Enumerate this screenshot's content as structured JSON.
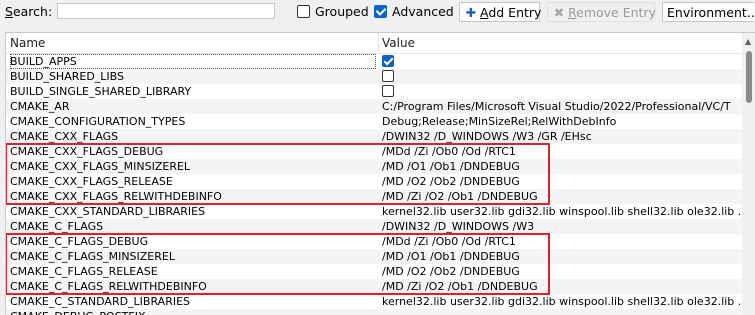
{
  "toolbar": {
    "search_label_first": "S",
    "search_label_rest": "earch:",
    "search_value": "",
    "grouped_label": "Grouped",
    "grouped_checked": false,
    "advanced_label": "Advanced",
    "advanced_checked": true,
    "add_entry_label_first": "A",
    "add_entry_label_rest": "dd Entry",
    "remove_entry_label_first": "R",
    "remove_entry_label_rest": "emove Entry",
    "environment_label": "Environment..."
  },
  "table": {
    "col_name": "Name",
    "col_value": "Value",
    "rows": [
      {
        "name": "BUILD_APPS",
        "type": "bool",
        "value": true
      },
      {
        "name": "BUILD_SHARED_LIBS",
        "type": "bool",
        "value": false
      },
      {
        "name": "BUILD_SINGLE_SHARED_LIBRARY",
        "type": "bool",
        "value": false
      },
      {
        "name": "CMAKE_AR",
        "type": "text",
        "value": "C:/Program Files/Microsoft Visual Studio/2022/Professional/VC/T"
      },
      {
        "name": "CMAKE_CONFIGURATION_TYPES",
        "type": "text",
        "value": "Debug;Release;MinSizeRel;RelWithDebInfo"
      },
      {
        "name": "CMAKE_CXX_FLAGS",
        "type": "text",
        "value": "/DWIN32 /D_WINDOWS /W3 /GR /EHsc"
      },
      {
        "name": "CMAKE_CXX_FLAGS_DEBUG",
        "type": "text",
        "value": "/MDd /Zi /Ob0 /Od /RTC1"
      },
      {
        "name": "CMAKE_CXX_FLAGS_MINSIZEREL",
        "type": "text",
        "value": "/MD /O1 /Ob1 /DNDEBUG"
      },
      {
        "name": "CMAKE_CXX_FLAGS_RELEASE",
        "type": "text",
        "value": "/MD /O2 /Ob2 /DNDEBUG"
      },
      {
        "name": "CMAKE_CXX_FLAGS_RELWITHDEBINFO",
        "type": "text",
        "value": "/MD /Zi /O2 /Ob1 /DNDEBUG"
      },
      {
        "name": "CMAKE_CXX_STANDARD_LIBRARIES",
        "type": "text",
        "value": "kernel32.lib user32.lib gdi32.lib winspool.lib shell32.lib ole32.lib ."
      },
      {
        "name": "CMAKE_C_FLAGS",
        "type": "text",
        "value": "/DWIN32 /D_WINDOWS /W3"
      },
      {
        "name": "CMAKE_C_FLAGS_DEBUG",
        "type": "text",
        "value": "/MDd /Zi /Ob0 /Od /RTC1"
      },
      {
        "name": "CMAKE_C_FLAGS_MINSIZEREL",
        "type": "text",
        "value": "/MD /O1 /Ob1 /DNDEBUG"
      },
      {
        "name": "CMAKE_C_FLAGS_RELEASE",
        "type": "text",
        "value": "/MD /O2 /Ob2 /DNDEBUG"
      },
      {
        "name": "CMAKE_C_FLAGS_RELWITHDEBINFO",
        "type": "text",
        "value": "/MD /Zi /O2 /Ob1 /DNDEBUG"
      },
      {
        "name": "CMAKE_C_STANDARD_LIBRARIES",
        "type": "text",
        "value": "kernel32.lib user32.lib gdi32.lib winspool.lib shell32.lib ole32.lib ."
      },
      {
        "name": "CMAKE_DEBUG_POSTFIX",
        "type": "text",
        "value": ""
      }
    ]
  },
  "colors": {
    "accent": "#0a64c8",
    "highlight_box": "#e0202a"
  },
  "icons": {
    "add": "plus-icon",
    "remove": "x-icon",
    "scroll_up": "up-arrow-icon"
  }
}
